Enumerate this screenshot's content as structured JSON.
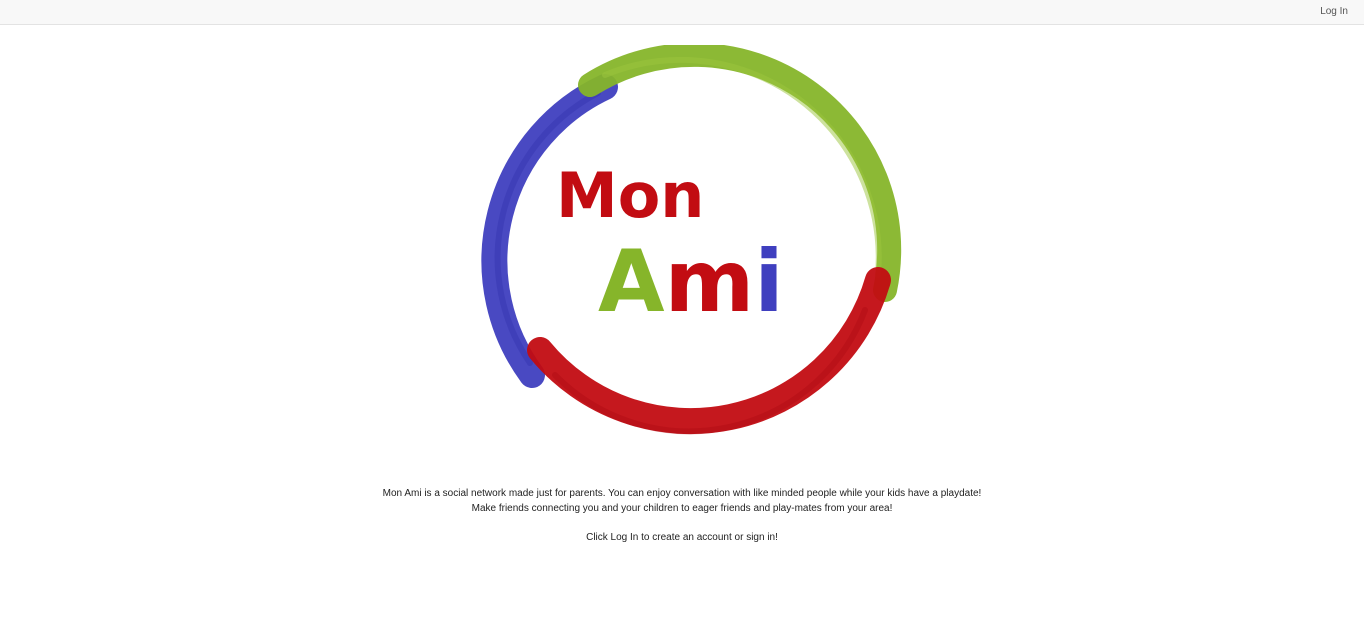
{
  "navbar": {
    "login_label": "Log In"
  },
  "logo": {
    "line1": "Mon",
    "line2_a": "Am",
    "line2_b": "i",
    "colors": {
      "blue": "#3f3fbf",
      "green": "#86b52a",
      "red": "#c20c12"
    }
  },
  "content": {
    "intro": "Mon Ami is a social network made just for parents. You can enjoy conversation with like minded people while your kids have a playdate! Make friends connecting you and your children to eager friends and play-mates from your area!",
    "cta": "Click Log In to create an account or sign in!"
  }
}
